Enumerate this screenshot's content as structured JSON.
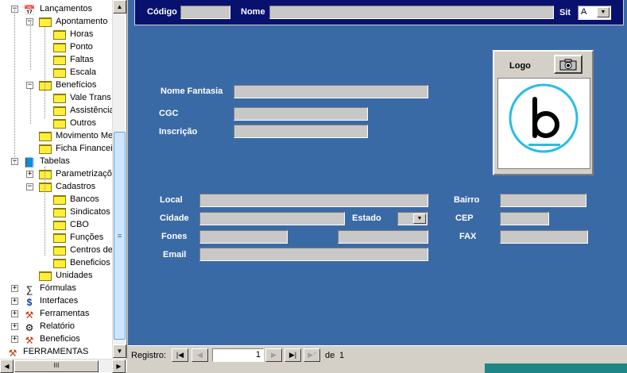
{
  "tree": {
    "items": [
      {
        "label": "Lançamentos",
        "level": 1,
        "icon": "calendar-icon",
        "expander": "−"
      },
      {
        "label": "Apontamento",
        "level": 2,
        "icon": "folder-icon",
        "expander": "−"
      },
      {
        "label": "Horas",
        "level": 3,
        "icon": "folder-icon",
        "expander": ""
      },
      {
        "label": "Ponto",
        "level": 3,
        "icon": "folder-icon",
        "expander": ""
      },
      {
        "label": "Faltas",
        "level": 3,
        "icon": "folder-icon",
        "expander": ""
      },
      {
        "label": "Escala",
        "level": 3,
        "icon": "folder-icon",
        "expander": ""
      },
      {
        "label": "Benefícios",
        "level": 2,
        "icon": "folder-icon",
        "expander": "−"
      },
      {
        "label": "Vale Trans",
        "level": 3,
        "icon": "folder-icon",
        "expander": ""
      },
      {
        "label": "Assistência",
        "level": 3,
        "icon": "folder-icon",
        "expander": ""
      },
      {
        "label": "Outros",
        "level": 3,
        "icon": "folder-icon",
        "expander": ""
      },
      {
        "label": "Movimento Me",
        "level": 2,
        "icon": "folder-icon",
        "expander": ""
      },
      {
        "label": "Ficha Financei",
        "level": 2,
        "icon": "folder-icon",
        "expander": ""
      },
      {
        "label": "Tabelas",
        "level": 1,
        "icon": "book-icon",
        "expander": "−"
      },
      {
        "label": "Parametrizaçõ",
        "level": 2,
        "icon": "folder-icon",
        "expander": "+"
      },
      {
        "label": "Cadastros",
        "level": 2,
        "icon": "folder-icon",
        "expander": "−"
      },
      {
        "label": "Bancos",
        "level": 3,
        "icon": "folder-icon",
        "expander": ""
      },
      {
        "label": "Sindicatos",
        "level": 3,
        "icon": "folder-icon",
        "expander": ""
      },
      {
        "label": "CBO",
        "level": 3,
        "icon": "folder-icon",
        "expander": ""
      },
      {
        "label": "Funções",
        "level": 3,
        "icon": "folder-icon",
        "expander": ""
      },
      {
        "label": "Centros de",
        "level": 3,
        "icon": "folder-icon",
        "expander": ""
      },
      {
        "label": "Beneficios",
        "level": 3,
        "icon": "folder-icon",
        "expander": ""
      },
      {
        "label": "Unidades",
        "level": 2,
        "icon": "folder-icon",
        "expander": ""
      },
      {
        "label": "Fórmulas",
        "level": 1,
        "icon": "formula-icon",
        "expander": "+"
      },
      {
        "label": "Interfaces",
        "level": 1,
        "icon": "dollar-icon",
        "expander": "+"
      },
      {
        "label": "Ferramentas",
        "level": 1,
        "icon": "tools-icon",
        "expander": "+"
      },
      {
        "label": "Relatório",
        "level": 1,
        "icon": "gear-icon",
        "expander": "+"
      },
      {
        "label": "Beneficios",
        "level": 1,
        "icon": "tools-icon",
        "expander": "+"
      },
      {
        "label": "FERRAMENTAS",
        "level": 0,
        "icon": "tools-icon",
        "expander": ""
      }
    ]
  },
  "header": {
    "codigo_label": "Código",
    "codigo_value": "",
    "nome_label": "Nome",
    "nome_value": "",
    "sit_label": "Sit",
    "sit_value": "A"
  },
  "form": {
    "nome_fantasia_label": "Nome Fantasia",
    "cgc_label": "CGC",
    "inscricao_label": "Inscrição",
    "local_label": "Local",
    "bairro_label": "Bairro",
    "cidade_label": "Cidade",
    "estado_label": "Estado",
    "cep_label": "CEP",
    "fones_label": "Fones",
    "fax_label": "FAX",
    "email_label": "Email"
  },
  "logo": {
    "label": "Logo",
    "button_icon": "camera-icon",
    "image_icon": "b-logo-icon",
    "accent": "#29bde6"
  },
  "nav": {
    "registro_label": "Registro:",
    "current": "1",
    "de_label": "de",
    "total": "1"
  },
  "colors": {
    "form_bg": "#3a6aa6",
    "header_bg": "#09116e",
    "field_bg": "#c8c8c8",
    "folder": "#ffef3a"
  }
}
